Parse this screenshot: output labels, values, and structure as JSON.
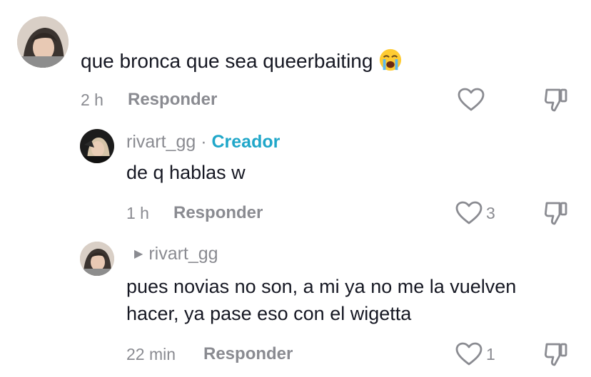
{
  "comments": [
    {
      "text": "que bronca que sea queerbaiting",
      "emoji": "loudly-crying-face-emoji",
      "time": "2 h",
      "reply_label": "Responder"
    }
  ],
  "replies": [
    {
      "username": "rivart_gg",
      "separator": " · ",
      "badge": "Creador",
      "text": "de q hablas w",
      "time": "1 h",
      "reply_label": "Responder",
      "likes": "3"
    },
    {
      "reply_to": "rivart_gg",
      "text_line1": "pues novias no son, a mi ya no me la vuelven",
      "text_line2": "hacer, ya pase eso con el wigetta",
      "time": "22 min",
      "reply_label": "Responder",
      "likes": "1"
    }
  ],
  "colors": {
    "text": "#161823",
    "muted": "#8a8b91",
    "creator": "#20a7c9"
  }
}
